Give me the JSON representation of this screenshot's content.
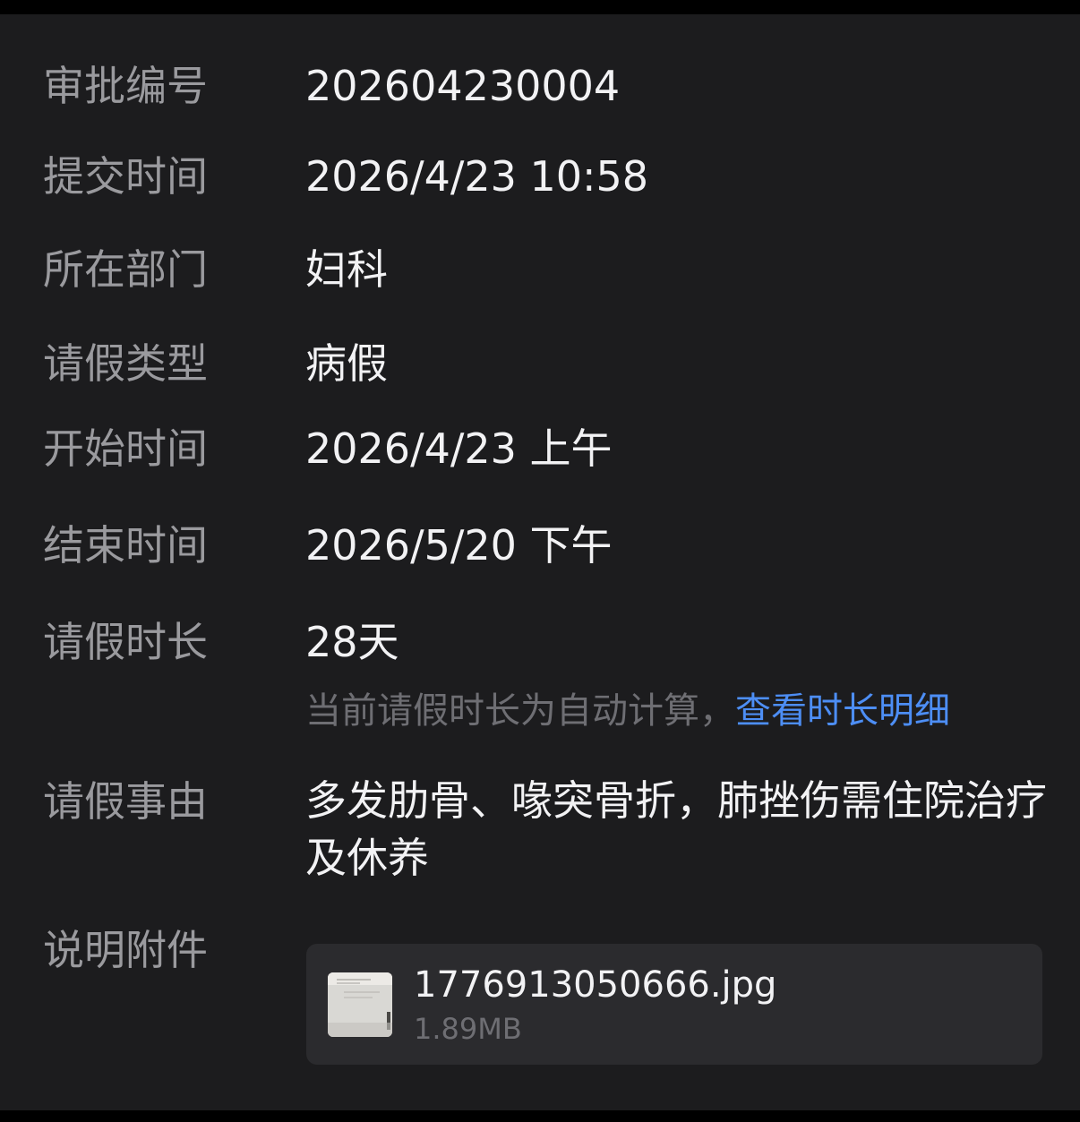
{
  "fields": [
    {
      "label": "审批编号",
      "value": "202604230004"
    },
    {
      "label": "提交时间",
      "value": "2026/4/23 10:58"
    },
    {
      "label": "所在部门",
      "value": "妇科"
    },
    {
      "label": "请假类型",
      "value": "病假"
    },
    {
      "label": "开始时间",
      "value": "2026/4/23 上午"
    },
    {
      "label": "结束时间",
      "value": "2026/5/20 下午"
    },
    {
      "label": "请假时长",
      "value": "28天"
    },
    {
      "label": "请假事由",
      "value": "多发肋骨、喙突骨折，肺挫伤需住院治疗及休养"
    },
    {
      "label": "说明附件"
    }
  ],
  "duration_hint": {
    "text": "当前请假时长为自动计算，",
    "link": "查看时长明细"
  },
  "attachment": {
    "name": "1776913050666.jpg",
    "size": "1.89MB",
    "thumbnail_icon": "image-thumbnail"
  },
  "colors": {
    "background": "#1c1c1e",
    "label": "#9a9a9e",
    "value": "#f2f2f4",
    "hint": "#6e6e73",
    "link": "#4d8ef5",
    "attachment_bg": "#2b2b2e"
  }
}
